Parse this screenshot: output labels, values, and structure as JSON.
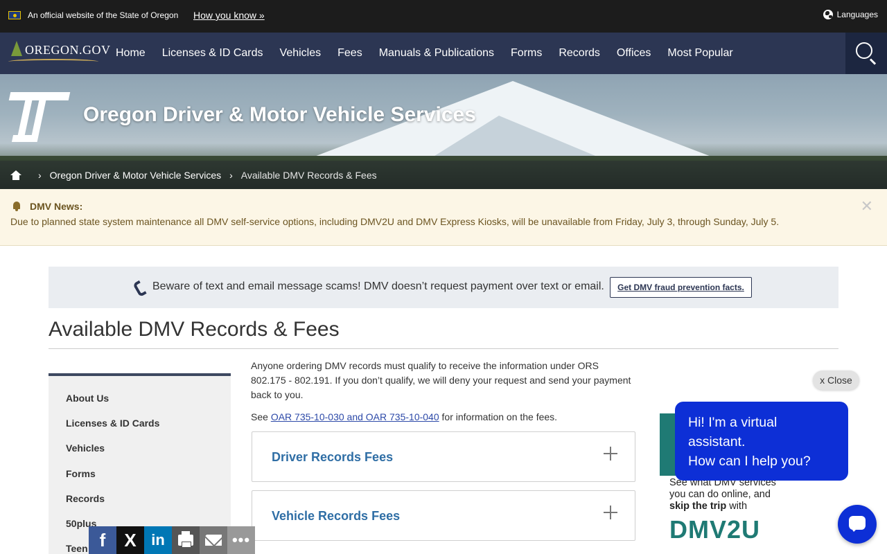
{
  "official_bar": {
    "text": "An official website of the State of Oregon",
    "how_link": "How you know »",
    "languages": "Languages"
  },
  "nav": {
    "logo_text": "OREGON.GOV",
    "items": [
      "Home",
      "Licenses & ID Cards",
      "Vehicles",
      "Fees",
      "Manuals & Publications",
      "Forms",
      "Records",
      "Offices",
      "Most Popular"
    ]
  },
  "hero": {
    "title": "Oregon Driver & Motor Vehicle Services",
    "breadcrumb": [
      "Oregon Driver & Motor Vehicle Services",
      "Available DMV Records & Fees"
    ]
  },
  "alert": {
    "title": "DMV News:",
    "text": "Due to planned state system maintenance all DMV self-service options, including DMV2U and DMV Express Kiosks, will be unavailable from Friday, July 3, through Sunday, July 5.",
    "close": "✕"
  },
  "scam": {
    "text": "Beware of text and email message scams! DMV doesn’t request payment over text or email.",
    "button": "Get DMV fraud prevention facts."
  },
  "page": {
    "title": "Available DMV Records & Fees"
  },
  "sidenav": {
    "items": [
      "About Us",
      "Licenses & ID Cards",
      "Vehicles",
      "Forms",
      "Records",
      "50plus",
      "Teen"
    ]
  },
  "content": {
    "intro": "Anyone ordering DMV records must qualify to receive the information under ORS 802.175 - 802.191. If you don’t qualify, we will deny your request and send your payment back to you.",
    "see_prefix": "See ",
    "see_link": "OAR 735-10-030 and OAR 735-10-040",
    "see_suffix": " for information on the fees.",
    "accordions": [
      "Driver Records Fees",
      "Vehicle Records Fees"
    ]
  },
  "promo": {
    "line1": "See what DMV services",
    "line2": "you can do online, and",
    "line3_bold": "skip the trip",
    "line3_rest": " with",
    "logo": "DMV2U"
  },
  "chat": {
    "close": "x Close",
    "line1": "Hi! I'm a virtual assistant.",
    "line2": "How can I help you?"
  },
  "share": {
    "facebook": "f",
    "x": "X",
    "linkedin": "in",
    "more": "•••"
  },
  "colors": {
    "nav_bg": "#2c3653",
    "chat_blue": "#0d2fd6",
    "accordion_title": "#2f6ea5",
    "dmv2u_teal": "#1f7a74"
  }
}
